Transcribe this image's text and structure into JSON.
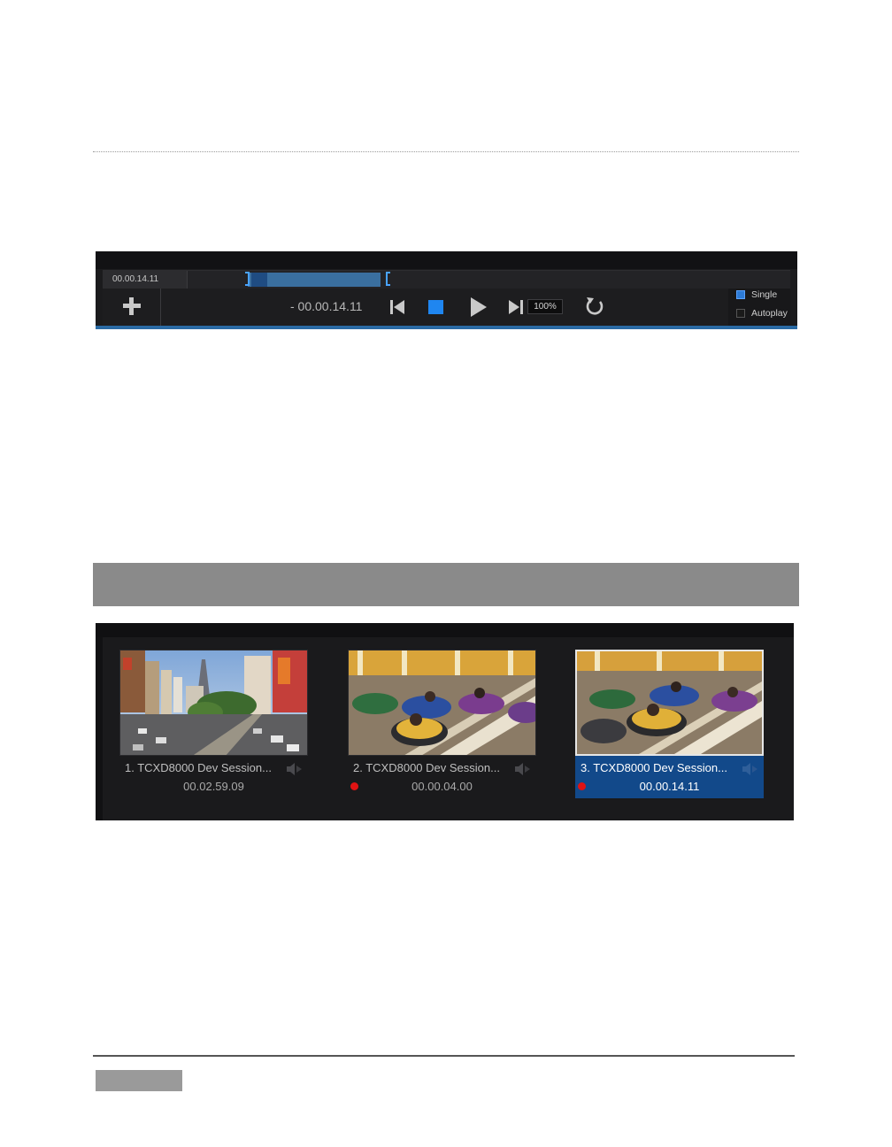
{
  "transport": {
    "timecode": "00.00.14.11",
    "remaining": "- 00.00.14.11",
    "zoom": "100%",
    "options": [
      {
        "label": "Single",
        "checked": true
      },
      {
        "label": "Autoplay",
        "checked": false
      }
    ],
    "icons": [
      "add-icon",
      "go-to-start-icon",
      "stop-icon",
      "play-icon",
      "go-to-end-icon",
      "loop-icon"
    ]
  },
  "bin": {
    "clips": [
      {
        "name": "1. TCXD8000 Dev Session...",
        "duration": "00.02.59.09",
        "selected": false,
        "record_dot": false
      },
      {
        "name": "2. TCXD8000 Dev Session...",
        "duration": "00.00.04.00",
        "selected": false,
        "record_dot": true
      },
      {
        "name": "3. TCXD8000 Dev Session...",
        "duration": "00.00.14.11",
        "selected": true,
        "record_dot": true
      }
    ]
  },
  "colors": {
    "accent": "#2d7bd6",
    "selection": "#12498a",
    "record": "#e01313",
    "panel": "#1b1b1d"
  }
}
